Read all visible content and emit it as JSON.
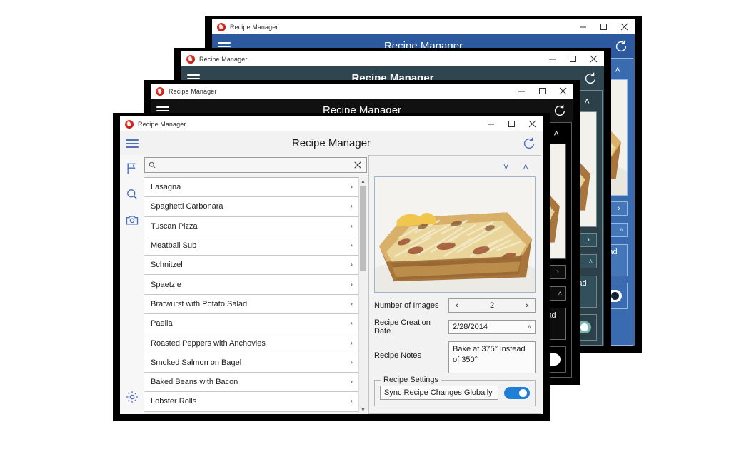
{
  "app": {
    "window_title": "Recipe Manager",
    "header_title": "Recipe Manager",
    "app_icon": "recipe-manager-app-icon",
    "menu_icon": "hamburger-menu-icon",
    "refresh_icon": "refresh-icon",
    "minimize_label": "─",
    "maximize_label": "□",
    "close_label": "✕"
  },
  "rail": {
    "items": [
      {
        "icon": "flag-icon",
        "name": "flag"
      },
      {
        "icon": "search-icon",
        "name": "search"
      },
      {
        "icon": "camera-icon",
        "name": "camera"
      }
    ],
    "bottom": {
      "icon": "gear-icon",
      "name": "settings"
    }
  },
  "search": {
    "value": "",
    "placeholder": "",
    "search_icon": "search-icon",
    "clear_icon": "close-icon"
  },
  "recipes": [
    {
      "name": "Lasagna",
      "chevron": "›"
    },
    {
      "name": "Spaghetti Carbonara",
      "chevron": "›"
    },
    {
      "name": "Tuscan Pizza",
      "chevron": "›"
    },
    {
      "name": "Meatball Sub",
      "chevron": "›"
    },
    {
      "name": "Schnitzel",
      "chevron": "›"
    },
    {
      "name": "Spaetzle",
      "chevron": "›"
    },
    {
      "name": "Bratwurst with Potato Salad",
      "chevron": "›"
    },
    {
      "name": "Paella",
      "chevron": "›"
    },
    {
      "name": "Roasted Peppers with Anchovies",
      "chevron": "›"
    },
    {
      "name": "Smoked Salmon on Bagel",
      "chevron": "›"
    },
    {
      "name": "Baked Beans with Bacon",
      "chevron": "›"
    },
    {
      "name": "Lobster Rolls",
      "chevron": "›"
    }
  ],
  "detail": {
    "prev_image_icon": "chevron-up-icon",
    "next_image_icon": "chevron-down-icon",
    "photo_alt": "lasagna-photo",
    "fields": {
      "number_of_images": {
        "label": "Number of Images",
        "value": "2",
        "prev": "‹",
        "next": "›"
      },
      "creation_date": {
        "label": "Recipe Creation Date",
        "value": "2/28/2014",
        "dropdown_icon": "chevron-down-icon"
      },
      "notes": {
        "label": "Recipe Notes",
        "value": "Bake at 375° instead of 350°"
      }
    },
    "settings_group": {
      "legend": "Recipe Settings",
      "sync_label": "Sync Recipe Changes Globally",
      "sync_enabled": true
    }
  },
  "themes": {
    "light": {
      "accent": "#1f7fd6",
      "icon": "#4a6fc0",
      "surface": "#f2f2f2"
    },
    "black": {
      "accent": "#ffffff",
      "icon": "#ffffff",
      "surface": "#000000"
    },
    "teal": {
      "accent": "#79b5ae",
      "icon": "#ffffff",
      "surface": "#2b4049"
    },
    "blue": {
      "accent": "#ffffff",
      "icon": "#ffffff",
      "surface": "#3a6ab0"
    }
  },
  "windows": [
    {
      "theme": "blue",
      "z": 1
    },
    {
      "theme": "teal",
      "z": 2
    },
    {
      "theme": "black",
      "z": 3
    },
    {
      "theme": "light",
      "z": 4
    }
  ]
}
